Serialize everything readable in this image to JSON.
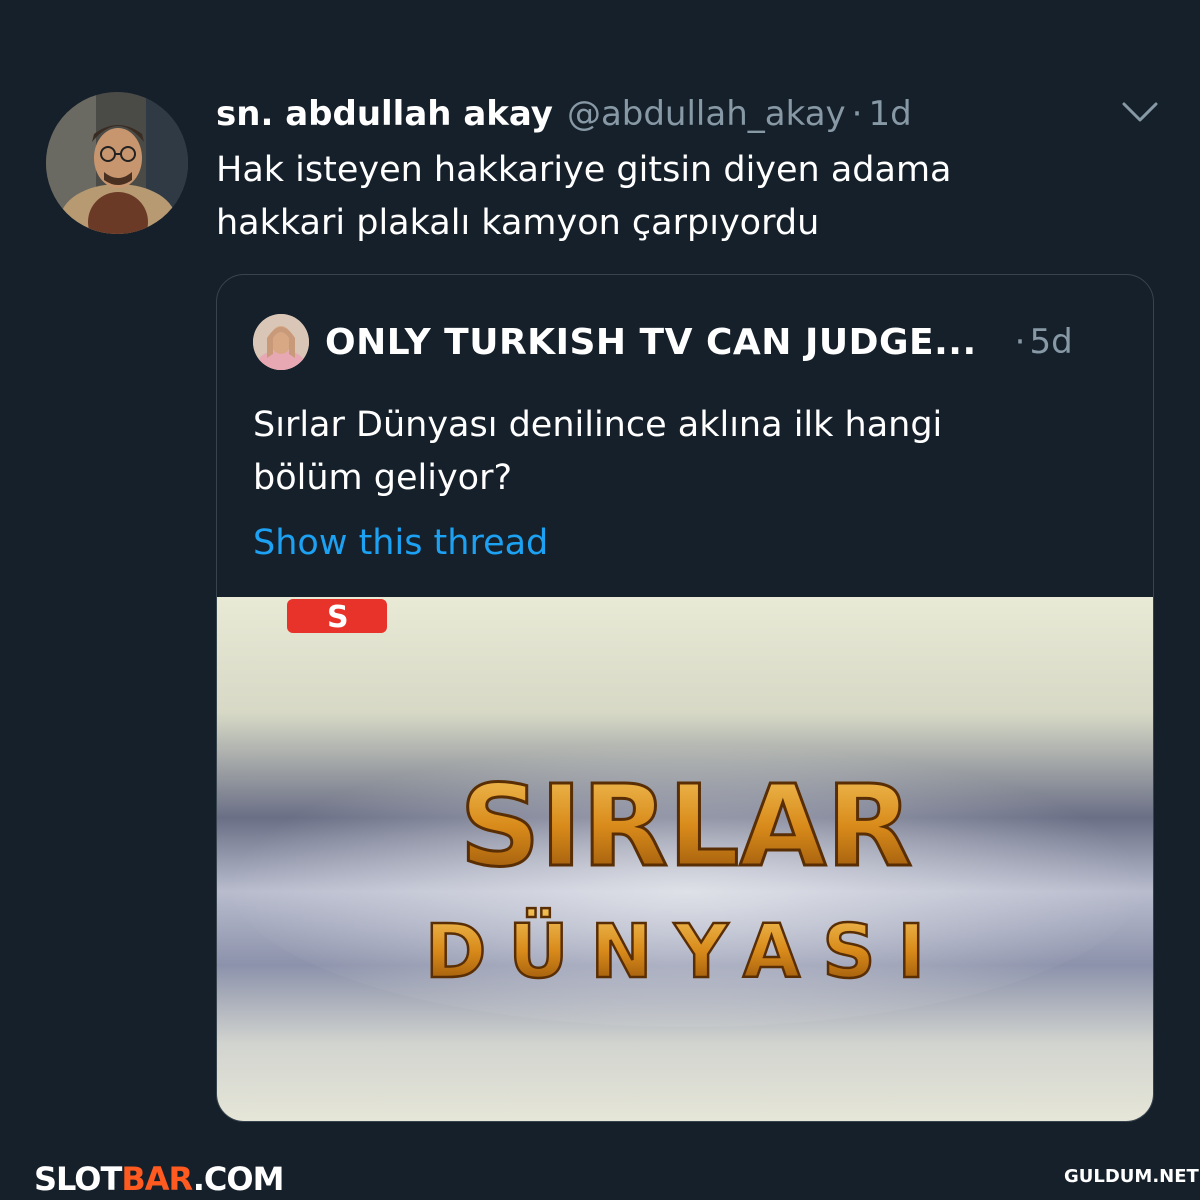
{
  "tweet": {
    "display_name": "sn. abdullah akay",
    "handle": "@abdullah_akay",
    "separator": "·",
    "time": "1d",
    "text_line1": "Hak isteyen hakkariye gitsin diyen adama",
    "text_line2": "hakkari plakalı kamyon çarpıyordu",
    "menu_icon": "chevron-down-icon"
  },
  "quote": {
    "display_name": "ONLY TURKISH TV CAN JUDGE...",
    "separator": "·",
    "time": "5d",
    "text_line1": "Sırlar Dünyası denilince aklına ilk hangi",
    "text_line2": "bölüm geliyor?",
    "show_thread": "Show this thread",
    "media": {
      "channel_logo": "S",
      "title_line1": "SIRLAR",
      "title_line2": "DÜNYASI"
    }
  },
  "watermarks": {
    "left_a": "SLOT",
    "left_b": "BAR",
    "left_c": ".COM",
    "right": "GULDUM.NET"
  },
  "colors": {
    "background": "#15202b",
    "secondary_text": "#8899a6",
    "link": "#1da1f2",
    "border": "#38444d"
  }
}
